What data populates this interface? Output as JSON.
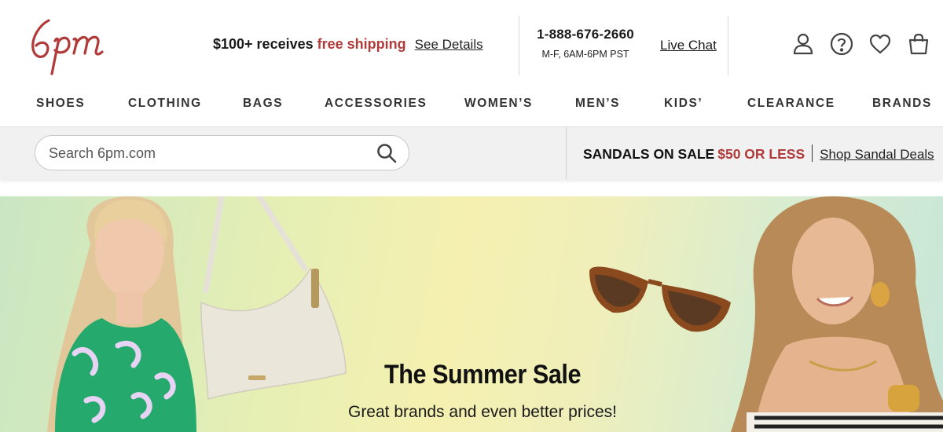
{
  "brand": {
    "logo_text": "6pm",
    "accent_color": "#b13a3a"
  },
  "promo": {
    "lead": "$100+ receives ",
    "highlight": "free shipping",
    "link": "See Details"
  },
  "contact": {
    "phone": "1-888-676-2660",
    "hours": "M-F, 6AM-6PM PST",
    "chat": "Live Chat"
  },
  "icons": [
    "account-icon",
    "help-icon",
    "favorites-heart-icon",
    "shopping-bag-icon"
  ],
  "nav": {
    "items": [
      "SHOES",
      "CLOTHING",
      "BAGS",
      "ACCESSORIES",
      "WOMEN’S",
      "MEN’S",
      "KIDS’",
      "CLEARANCE",
      "BRANDS"
    ]
  },
  "search": {
    "placeholder": "Search 6pm.com",
    "value": ""
  },
  "sale_banner": {
    "headline": "SANDALS ON SALE",
    "price": "$50 OR LESS",
    "link": "Shop Sandal Deals"
  },
  "hero": {
    "title": "The Summer Sale",
    "subtitle": "Great brands and even better prices!"
  }
}
